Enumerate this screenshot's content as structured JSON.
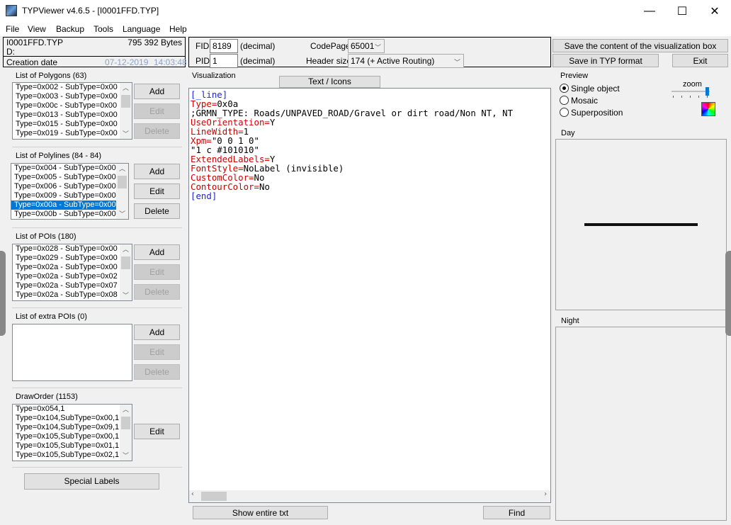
{
  "window": {
    "title": "TYPViewer v4.6.5 - [I0001FFD.TYP]",
    "minimize": "—",
    "maximize": "☐",
    "close": "✕"
  },
  "menu": [
    "File",
    "View",
    "Backup",
    "Tools",
    "Language",
    "Help"
  ],
  "fileinfo": {
    "name": "I0001FFD.TYP",
    "size": "795 392 Bytes",
    "drive": "D:",
    "creation_label": "Creation date",
    "date": "07-12-2019",
    "time": "14:03:48"
  },
  "header": {
    "fid_label": "FID",
    "fid_value": "8189",
    "fid_unit": "(decimal)",
    "pid_label": "PID",
    "pid_value": "1",
    "pid_unit": "(decimal)",
    "codepage_label": "CodePage",
    "codepage_value": "65001",
    "header_size_label": "Header size",
    "header_size_value": "174 (+ Active Routing)",
    "save_visual_btn": "Save the content of the visualization box",
    "save_typ_btn": "Save in TYP format",
    "exit_btn": "Exit"
  },
  "buttons": {
    "add": "Add",
    "edit": "Edit",
    "delete": "Delete",
    "special_labels": "Special Labels",
    "show_entire": "Show entire txt",
    "find": "Find",
    "text_icons": "Text / Icons"
  },
  "polygons": {
    "label": "List of Polygons  (63)",
    "items": [
      "Type=0x002 - SubType=0x00",
      "Type=0x003 - SubType=0x00",
      "Type=0x00c - SubType=0x00",
      "Type=0x013 - SubType=0x00",
      "Type=0x015 - SubType=0x00",
      "Type=0x019 - SubType=0x00"
    ]
  },
  "polylines": {
    "label": "List of Polylines  (84 - 84)",
    "items": [
      "Type=0x004 - SubType=0x00",
      "Type=0x005 - SubType=0x00",
      "Type=0x006 - SubType=0x00",
      "Type=0x009 - SubType=0x00",
      "Type=0x00a - SubType=0x00",
      "Type=0x00b - SubType=0x00"
    ]
  },
  "pois": {
    "label": "List of POIs  (180)",
    "items": [
      "Type=0x028 - SubType=0x00",
      "Type=0x029 - SubType=0x00",
      "Type=0x02a - SubType=0x00",
      "Type=0x02a - SubType=0x02",
      "Type=0x02a - SubType=0x07",
      "Type=0x02a - SubType=0x08"
    ]
  },
  "extra_pois": {
    "label": "List of extra POIs  (0)"
  },
  "draworder": {
    "label": "DrawOrder  (1153)",
    "items": [
      "Type=0x054,1",
      "Type=0x104,SubType=0x00,1",
      "Type=0x104,SubType=0x09,1",
      "Type=0x105,SubType=0x00,1",
      "Type=0x105,SubType=0x01,1",
      "Type=0x105,SubType=0x02,1"
    ]
  },
  "visualization": {
    "label": "Visualization"
  },
  "code": {
    "l1": "[_line]",
    "l2k": "Type=",
    "l2v": "0x0a",
    "l3": ";GRMN_TYPE: Roads/UNPAVED_ROAD/Gravel or dirt road/Non NT, NT",
    "l4k": "UseOrientation=",
    "l4v": "Y",
    "l5k": "LineWidth=",
    "l5v": "1",
    "l6k": "Xpm=",
    "l6v": "\"0 0 1 0\"",
    "l7": "\"1 c #101010\"",
    "l8k": "ExtendedLabels=",
    "l8v": "Y",
    "l9k": "FontStyle=",
    "l9v": "NoLabel (invisible)",
    "l10k": "CustomColor=",
    "l10v": "No",
    "l11k": "ContourColor=",
    "l11v": "No",
    "l12": "[end]"
  },
  "preview": {
    "label": "Preview",
    "single": "Single object",
    "mosaic": "Mosaic",
    "superposition": "Superposition",
    "zoom": "zoom",
    "day": "Day",
    "night": "Night"
  },
  "colors": {
    "selection": "#0078d7",
    "keyword": "#d00000",
    "section": "#1f1fd6",
    "preview_line": "#101010"
  }
}
